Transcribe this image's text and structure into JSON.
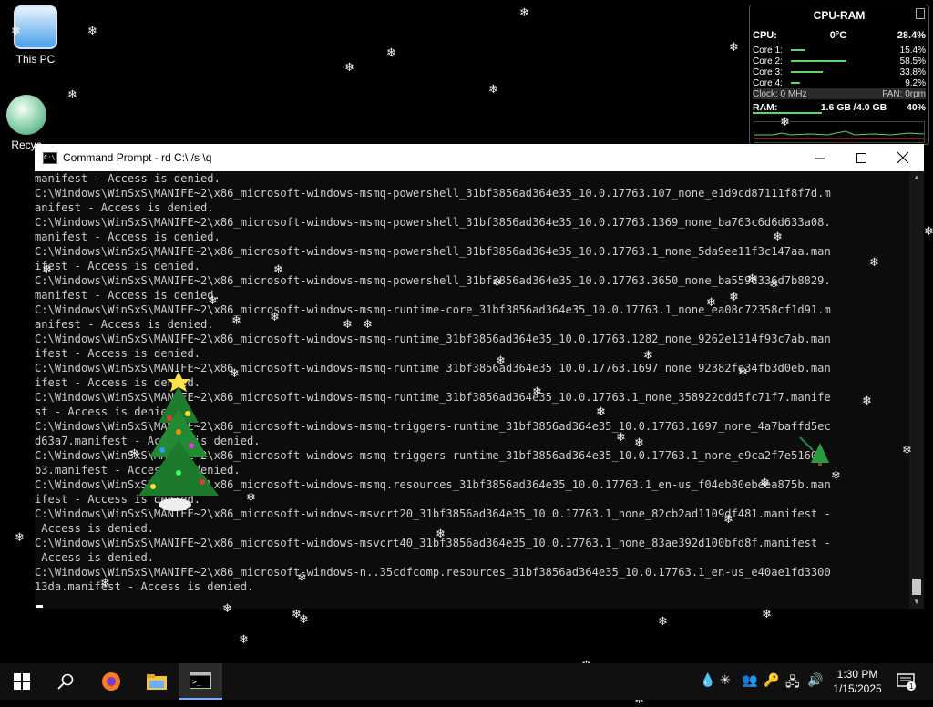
{
  "desktop": {
    "icons": [
      {
        "label": "This PC"
      },
      {
        "label": "Recyc"
      }
    ]
  },
  "gadget": {
    "title": "CPU-RAM",
    "cpu_label": "CPU:",
    "cpu_temp": "0°C",
    "cpu_usage": "28.4%",
    "cores": [
      {
        "label": "Core 1:",
        "value": "15.4%",
        "level": 0.154
      },
      {
        "label": "Core 2:",
        "value": "58.5%",
        "level": 0.585
      },
      {
        "label": "Core 3:",
        "value": "33.8%",
        "level": 0.338
      },
      {
        "label": "Core 4:",
        "value": "9.2%",
        "level": 0.092
      }
    ],
    "clock_label": "Clock: 0 MHz",
    "fan_label": "FAN: 0rpm",
    "ram_label": "RAM:",
    "ram_used": "1.6 GB",
    "ram_total": "4.0 GB",
    "ram_usage": "40%",
    "accent_color": "#5fd36e"
  },
  "console": {
    "title": "Command Prompt - rd  C:\\ /s \\q",
    "minimize_icon": "minimize-icon",
    "maximize_icon": "maximize-icon",
    "close_icon": "close-icon",
    "lines": [
      "manifest - Access is denied.",
      "C:\\Windows\\WinSxS\\MANIFE~2\\x86_microsoft-windows-msmq-powershell_31bf3856ad364e35_10.0.17763.107_none_e1d9cd87111f8f7d.m",
      "anifest - Access is denied.",
      "C:\\Windows\\WinSxS\\MANIFE~2\\x86_microsoft-windows-msmq-powershell_31bf3856ad364e35_10.0.17763.1369_none_ba763c6d6d633a08.",
      "manifest - Access is denied.",
      "C:\\Windows\\WinSxS\\MANIFE~2\\x86_microsoft-windows-msmq-powershell_31bf3856ad364e35_10.0.17763.1_none_5da9ee11f3c147aa.man",
      "ifest - Access is denied.",
      "C:\\Windows\\WinSxS\\MANIFE~2\\x86_microsoft-windows-msmq-powershell_31bf3856ad364e35_10.0.17763.3650_none_ba559d336d7b8829.",
      "manifest - Access is denied.",
      "C:\\Windows\\WinSxS\\MANIFE~2\\x86_microsoft-windows-msmq-runtime-core_31bf3856ad364e35_10.0.17763.1_none_ea08c72358cf1d91.m",
      "anifest - Access is denied.",
      "C:\\Windows\\WinSxS\\MANIFE~2\\x86_microsoft-windows-msmq-runtime_31bf3856ad364e35_10.0.17763.1282_none_9262e1314f93c7ab.man",
      "ifest - Access is denied.",
      "C:\\Windows\\WinSxS\\MANIFE~2\\x86_microsoft-windows-msmq-runtime_31bf3856ad364e35_10.0.17763.1697_none_92382fe34fb3d0eb.man",
      "ifest - Access is denied.",
      "C:\\Windows\\WinSxS\\MANIFE~2\\x86_microsoft-windows-msmq-runtime_31bf3856ad364e35_10.0.17763.1_none_358922ddd5fc71f7.manife",
      "st - Access is denied.",
      "C:\\Windows\\WinSxS\\MANIFE~2\\x86_microsoft-windows-msmq-triggers-runtime_31bf3856ad364e35_10.0.17763.1697_none_4a7baffd5ec",
      "d63a7.manifest - Access is denied.",
      "C:\\Windows\\WinSxS\\MANIFE~2\\x86_microsoft-windows-msmq-triggers-runtime_31bf3856ad364e35_10.0.17763.1_none_e9ca2f7e51604",
      "b3.manifest - Access is denied.",
      "C:\\Windows\\WinSxS\\MANIFE~2\\x86_microsoft-windows-msmq.resources_31bf3856ad364e35_10.0.17763.1_en-us_f04eb80ebeea875b.man",
      "ifest - Access is denied.",
      "C:\\Windows\\WinSxS\\MANIFE~2\\x86_microsoft-windows-msvcrt20_31bf3856ad364e35_10.0.17763.1_none_82cb2ad1109df481.manifest -",
      " Access is denied.",
      "C:\\Windows\\WinSxS\\MANIFE~2\\x86_microsoft-windows-msvcrt40_31bf3856ad364e35_10.0.17763.1_none_83ae392d100bfd8f.manifest -",
      " Access is denied.",
      "C:\\Windows\\WinSxS\\MANIFE~2\\x86_microsoft-windows-n..35cdfcomp.resources_31bf3856ad364e35_10.0.17763.1_en-us_e40ae1fd3300",
      "13da.manifest - Access is denied.",
      ""
    ]
  },
  "taskbar": {
    "items": [
      {
        "icon": "windows-start-icon"
      },
      {
        "icon": "search-icon"
      },
      {
        "icon": "firefox-icon"
      },
      {
        "icon": "file-explorer-icon"
      },
      {
        "icon": "command-prompt-icon"
      }
    ],
    "tray_icons": [
      "water-drop-icon",
      "snowflake-icon",
      "users-icon",
      "key-icon",
      "network-icon",
      "volume-icon"
    ],
    "time": "1:30 PM",
    "date": "1/15/2025",
    "notification_count": "1"
  }
}
